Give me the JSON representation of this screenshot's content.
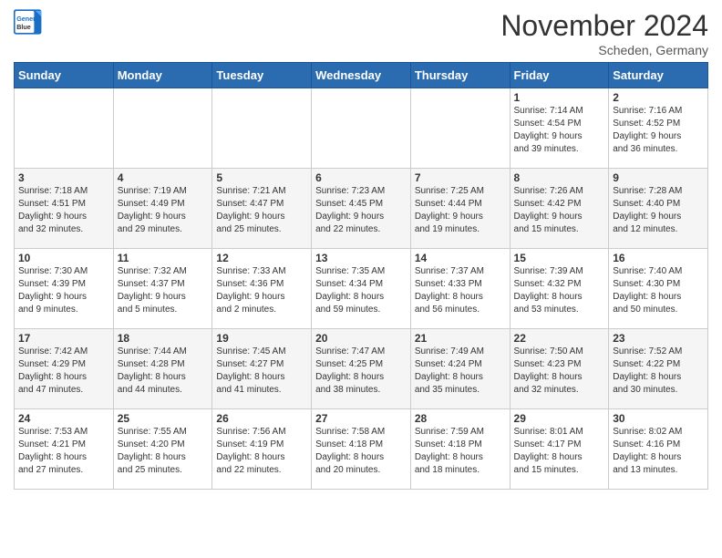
{
  "header": {
    "logo_line1": "General",
    "logo_line2": "Blue",
    "month": "November 2024",
    "location": "Scheden, Germany"
  },
  "weekdays": [
    "Sunday",
    "Monday",
    "Tuesday",
    "Wednesday",
    "Thursday",
    "Friday",
    "Saturday"
  ],
  "weeks": [
    [
      {
        "day": "",
        "info": ""
      },
      {
        "day": "",
        "info": ""
      },
      {
        "day": "",
        "info": ""
      },
      {
        "day": "",
        "info": ""
      },
      {
        "day": "",
        "info": ""
      },
      {
        "day": "1",
        "info": "Sunrise: 7:14 AM\nSunset: 4:54 PM\nDaylight: 9 hours\nand 39 minutes."
      },
      {
        "day": "2",
        "info": "Sunrise: 7:16 AM\nSunset: 4:52 PM\nDaylight: 9 hours\nand 36 minutes."
      }
    ],
    [
      {
        "day": "3",
        "info": "Sunrise: 7:18 AM\nSunset: 4:51 PM\nDaylight: 9 hours\nand 32 minutes."
      },
      {
        "day": "4",
        "info": "Sunrise: 7:19 AM\nSunset: 4:49 PM\nDaylight: 9 hours\nand 29 minutes."
      },
      {
        "day": "5",
        "info": "Sunrise: 7:21 AM\nSunset: 4:47 PM\nDaylight: 9 hours\nand 25 minutes."
      },
      {
        "day": "6",
        "info": "Sunrise: 7:23 AM\nSunset: 4:45 PM\nDaylight: 9 hours\nand 22 minutes."
      },
      {
        "day": "7",
        "info": "Sunrise: 7:25 AM\nSunset: 4:44 PM\nDaylight: 9 hours\nand 19 minutes."
      },
      {
        "day": "8",
        "info": "Sunrise: 7:26 AM\nSunset: 4:42 PM\nDaylight: 9 hours\nand 15 minutes."
      },
      {
        "day": "9",
        "info": "Sunrise: 7:28 AM\nSunset: 4:40 PM\nDaylight: 9 hours\nand 12 minutes."
      }
    ],
    [
      {
        "day": "10",
        "info": "Sunrise: 7:30 AM\nSunset: 4:39 PM\nDaylight: 9 hours\nand 9 minutes."
      },
      {
        "day": "11",
        "info": "Sunrise: 7:32 AM\nSunset: 4:37 PM\nDaylight: 9 hours\nand 5 minutes."
      },
      {
        "day": "12",
        "info": "Sunrise: 7:33 AM\nSunset: 4:36 PM\nDaylight: 9 hours\nand 2 minutes."
      },
      {
        "day": "13",
        "info": "Sunrise: 7:35 AM\nSunset: 4:34 PM\nDaylight: 8 hours\nand 59 minutes."
      },
      {
        "day": "14",
        "info": "Sunrise: 7:37 AM\nSunset: 4:33 PM\nDaylight: 8 hours\nand 56 minutes."
      },
      {
        "day": "15",
        "info": "Sunrise: 7:39 AM\nSunset: 4:32 PM\nDaylight: 8 hours\nand 53 minutes."
      },
      {
        "day": "16",
        "info": "Sunrise: 7:40 AM\nSunset: 4:30 PM\nDaylight: 8 hours\nand 50 minutes."
      }
    ],
    [
      {
        "day": "17",
        "info": "Sunrise: 7:42 AM\nSunset: 4:29 PM\nDaylight: 8 hours\nand 47 minutes."
      },
      {
        "day": "18",
        "info": "Sunrise: 7:44 AM\nSunset: 4:28 PM\nDaylight: 8 hours\nand 44 minutes."
      },
      {
        "day": "19",
        "info": "Sunrise: 7:45 AM\nSunset: 4:27 PM\nDaylight: 8 hours\nand 41 minutes."
      },
      {
        "day": "20",
        "info": "Sunrise: 7:47 AM\nSunset: 4:25 PM\nDaylight: 8 hours\nand 38 minutes."
      },
      {
        "day": "21",
        "info": "Sunrise: 7:49 AM\nSunset: 4:24 PM\nDaylight: 8 hours\nand 35 minutes."
      },
      {
        "day": "22",
        "info": "Sunrise: 7:50 AM\nSunset: 4:23 PM\nDaylight: 8 hours\nand 32 minutes."
      },
      {
        "day": "23",
        "info": "Sunrise: 7:52 AM\nSunset: 4:22 PM\nDaylight: 8 hours\nand 30 minutes."
      }
    ],
    [
      {
        "day": "24",
        "info": "Sunrise: 7:53 AM\nSunset: 4:21 PM\nDaylight: 8 hours\nand 27 minutes."
      },
      {
        "day": "25",
        "info": "Sunrise: 7:55 AM\nSunset: 4:20 PM\nDaylight: 8 hours\nand 25 minutes."
      },
      {
        "day": "26",
        "info": "Sunrise: 7:56 AM\nSunset: 4:19 PM\nDaylight: 8 hours\nand 22 minutes."
      },
      {
        "day": "27",
        "info": "Sunrise: 7:58 AM\nSunset: 4:18 PM\nDaylight: 8 hours\nand 20 minutes."
      },
      {
        "day": "28",
        "info": "Sunrise: 7:59 AM\nSunset: 4:18 PM\nDaylight: 8 hours\nand 18 minutes."
      },
      {
        "day": "29",
        "info": "Sunrise: 8:01 AM\nSunset: 4:17 PM\nDaylight: 8 hours\nand 15 minutes."
      },
      {
        "day": "30",
        "info": "Sunrise: 8:02 AM\nSunset: 4:16 PM\nDaylight: 8 hours\nand 13 minutes."
      }
    ]
  ]
}
